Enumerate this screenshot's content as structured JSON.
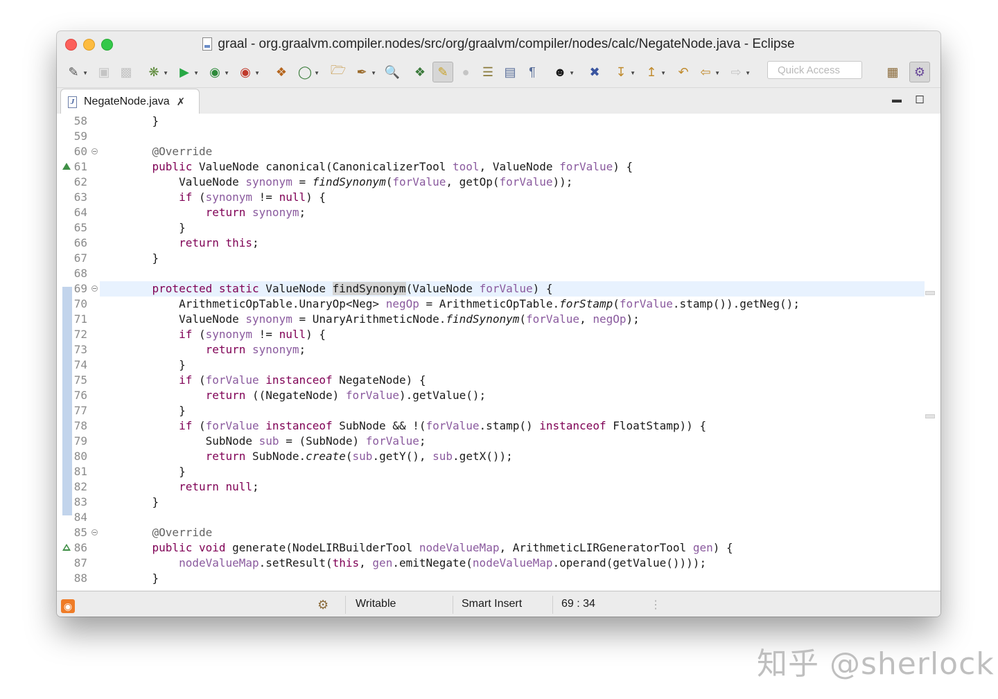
{
  "window": {
    "title": "graal - org.graalvm.compiler.nodes/src/org/graalvm/compiler/nodes/calc/NegateNode.java - Eclipse"
  },
  "toolbar": {
    "quick_access_placeholder": "Quick Access",
    "icons": [
      "new-wizard-icon",
      "save-icon",
      "save-all-icon",
      "debug-icon",
      "run-icon",
      "coverage-icon",
      "external-tools-icon",
      "new-java-package-icon",
      "new-java-class-icon",
      "open-type-icon",
      "open-task-icon",
      "search-icon",
      "toggle-breadcrumb-icon",
      "toggle-mark-occurrences-icon",
      "toggle-block-selection-icon",
      "show-whitespace-icon",
      "annotation-next-icon",
      "annotation-prev-icon",
      "last-edit-location-icon",
      "back-icon",
      "forward-icon",
      "perspective-open-icon",
      "java-perspective-icon"
    ]
  },
  "editor_tab": {
    "label": "NegateNode.java"
  },
  "editor": {
    "lines": [
      {
        "n": "58"
      },
      {
        "n": "59"
      },
      {
        "n": "60"
      },
      {
        "n": "61"
      },
      {
        "n": "62"
      },
      {
        "n": "63"
      },
      {
        "n": "64"
      },
      {
        "n": "65"
      },
      {
        "n": "66"
      },
      {
        "n": "67"
      },
      {
        "n": "68"
      },
      {
        "n": "69"
      },
      {
        "n": "70"
      },
      {
        "n": "71"
      },
      {
        "n": "72"
      },
      {
        "n": "73"
      },
      {
        "n": "74"
      },
      {
        "n": "75"
      },
      {
        "n": "76"
      },
      {
        "n": "77"
      },
      {
        "n": "78"
      },
      {
        "n": "79"
      },
      {
        "n": "80"
      },
      {
        "n": "81"
      },
      {
        "n": "82"
      },
      {
        "n": "83"
      },
      {
        "n": "84"
      },
      {
        "n": "85"
      },
      {
        "n": "86"
      },
      {
        "n": "87"
      },
      {
        "n": "88"
      }
    ],
    "code": {
      "l58": "    }",
      "l59": "",
      "l60": "    @Override",
      "l61": [
        "    ",
        "public",
        " ValueNode canonical(CanonicalizerTool ",
        "tool",
        ", ValueNode ",
        "forValue",
        ") {"
      ],
      "l62": [
        "        ValueNode ",
        "synonym",
        " = ",
        "findSynonym",
        "(",
        "forValue",
        ", getOp(",
        "forValue",
        "));"
      ],
      "l63": [
        "        ",
        "if",
        " (",
        "synonym",
        " != ",
        "null",
        ") {"
      ],
      "l64": [
        "            ",
        "return",
        " ",
        "synonym",
        ";"
      ],
      "l65": "        }",
      "l66": [
        "        ",
        "return",
        " ",
        "this",
        ";"
      ],
      "l67": "    }",
      "l68": "",
      "l69": [
        "    ",
        "protected",
        " ",
        "static",
        " ValueNode ",
        "findSynonym",
        "(ValueNode ",
        "forValue",
        ") {"
      ],
      "l70": [
        "        ArithmeticOpTable.UnaryOp<Neg> ",
        "negOp",
        " = ArithmeticOpTable.",
        "forStamp",
        "(",
        "forValue",
        ".stamp()).getNeg();"
      ],
      "l71": [
        "        ValueNode ",
        "synonym",
        " = UnaryArithmeticNode.",
        "findSynonym",
        "(",
        "forValue",
        ", ",
        "negOp",
        ");"
      ],
      "l72": [
        "        ",
        "if",
        " (",
        "synonym",
        " != ",
        "null",
        ") {"
      ],
      "l73": [
        "            ",
        "return",
        " ",
        "synonym",
        ";"
      ],
      "l74": "        }",
      "l75": [
        "        ",
        "if",
        " (",
        "forValue",
        " ",
        "instanceof",
        " NegateNode) {"
      ],
      "l76": [
        "            ",
        "return",
        " ((NegateNode) ",
        "forValue",
        ").getValue();"
      ],
      "l77": "        }",
      "l78": [
        "        ",
        "if",
        " (",
        "forValue",
        " ",
        "instanceof",
        " SubNode && !(",
        "forValue",
        ".stamp() ",
        "instanceof",
        " FloatStamp)) {"
      ],
      "l79": [
        "            SubNode ",
        "sub",
        " = (SubNode) ",
        "forValue",
        ";"
      ],
      "l80": [
        "            ",
        "return",
        " SubNode.",
        "create",
        "(",
        "sub",
        ".getY(), ",
        "sub",
        ".getX());"
      ],
      "l81": "        }",
      "l82": [
        "        ",
        "return",
        " ",
        "null",
        ";"
      ],
      "l83": "    }",
      "l84": "",
      "l85": "    @Override",
      "l86": [
        "    ",
        "public",
        " ",
        "void",
        " generate(NodeLIRBuilderTool ",
        "nodeValueMap",
        ", ArithmeticLIRGeneratorTool ",
        "gen",
        ") {"
      ],
      "l87": [
        "        ",
        "nodeValueMap",
        ".setResult(",
        "this",
        ", ",
        "gen",
        ".emitNegate(",
        "nodeValueMap",
        ".operand(getValue())));"
      ],
      "l88": "    }"
    }
  },
  "status": {
    "writable": "Writable",
    "insert_mode": "Smart Insert",
    "cursor_position": "69 : 34"
  },
  "watermark": "知乎 @sherlock"
}
